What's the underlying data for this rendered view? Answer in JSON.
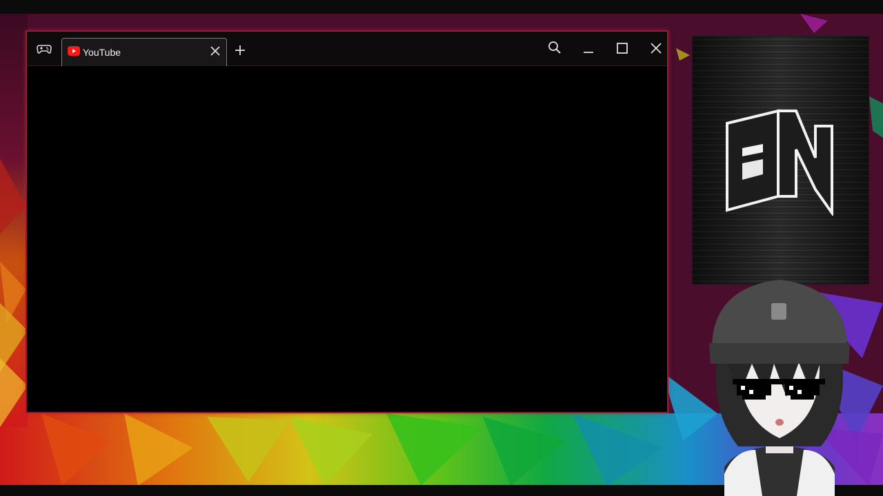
{
  "browser": {
    "tabs": [
      {
        "title": "YouTube",
        "icon": "youtube-icon"
      }
    ],
    "new_tab_icon": "plus-icon",
    "controls": [
      "search-icon",
      "minimize-icon",
      "maximize-icon",
      "close-icon"
    ],
    "frame_color": "#8a2232"
  },
  "logo": {
    "text": "EN"
  },
  "avatar": {
    "description_icon": "vtuber-avatar"
  }
}
